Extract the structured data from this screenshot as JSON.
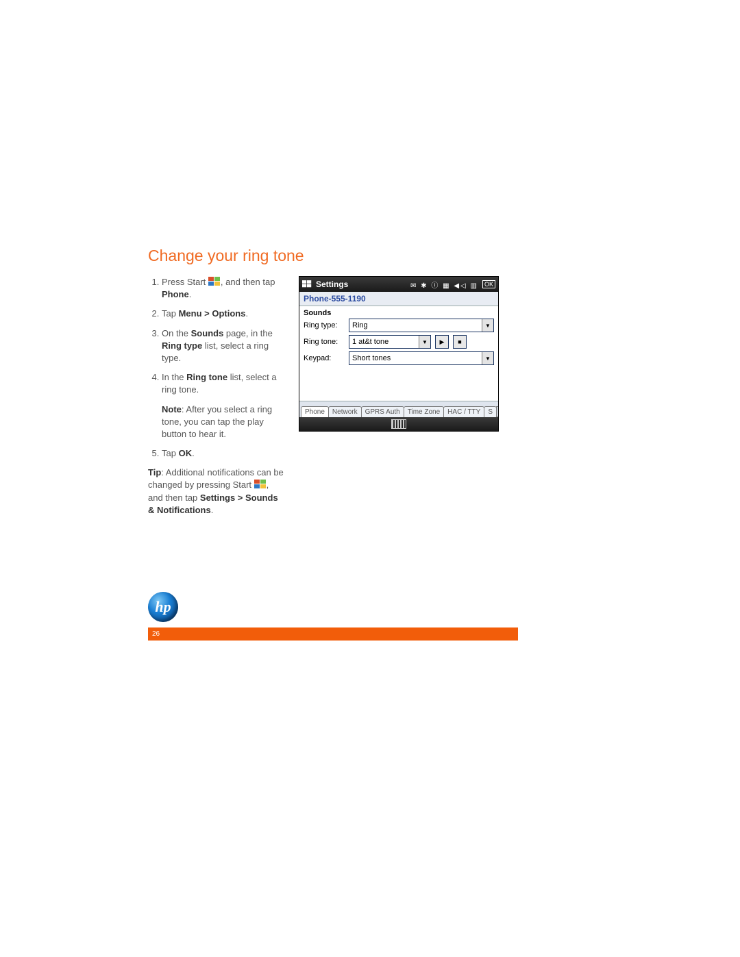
{
  "heading": "Change your ring tone",
  "steps": {
    "s1a": "Press Start ",
    "s1b": ", and then tap ",
    "s1phone": "Phone",
    "s1c": ".",
    "s2a": "Tap ",
    "s2b": "Menu > Options",
    "s2c": ".",
    "s3a": "On the ",
    "s3b": "Sounds",
    "s3c": " page, in the ",
    "s3d": "Ring type",
    "s3e": " list, select a ring type.",
    "s4a": "In the ",
    "s4b": "Ring tone",
    "s4c": " list, select a ring tone.",
    "noteLabel": "Note",
    "noteText": ":  After you select a ring tone, you can tap the play button to hear it.",
    "s5a": "Tap ",
    "s5b": "OK",
    "s5c": "."
  },
  "tip": {
    "label": "Tip",
    "a": ":  Additional notifications can be changed by pressing Start ",
    "b": ", and then tap ",
    "c": "Settings > Sounds & Notifications",
    "d": "."
  },
  "device": {
    "topTitle": "Settings",
    "statusOK": "OK",
    "subheader": "Phone-555-1190",
    "section": "Sounds",
    "rowRingType": "Ring type:",
    "valRingType": "Ring",
    "rowRingTone": "Ring tone:",
    "valRingTone": "1 at&t tone",
    "rowKeypad": "Keypad:",
    "valKeypad": "Short tones",
    "tabs": [
      "Phone",
      "Network",
      "GPRS Auth",
      "Time Zone",
      "HAC / TTY",
      "S"
    ]
  },
  "logo": "hp",
  "pageNumber": "26"
}
